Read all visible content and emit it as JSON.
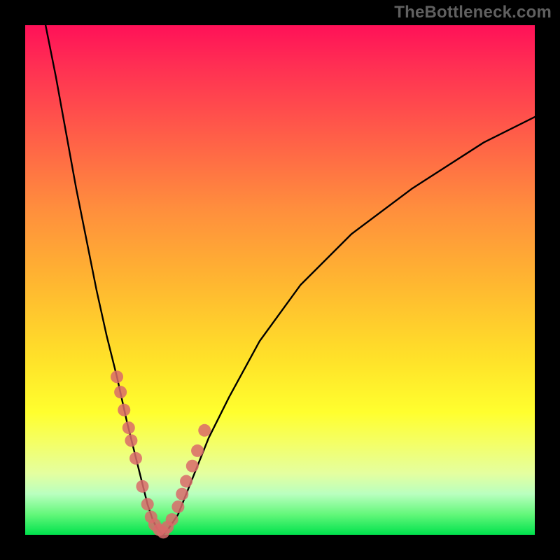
{
  "watermark": "TheBottleneck.com",
  "chart_data": {
    "type": "line",
    "title": "",
    "xlabel": "",
    "ylabel": "",
    "xlim": [
      0,
      100
    ],
    "ylim": [
      0,
      100
    ],
    "grid": false,
    "legend": false,
    "series": [
      {
        "name": "bottleneck-curve",
        "x": [
          4,
          6,
          8,
          10,
          12,
          14,
          16,
          18,
          20,
          22,
          23,
          24,
          25,
          26,
          27,
          28,
          30,
          32,
          34,
          36,
          40,
          46,
          54,
          64,
          76,
          90,
          100
        ],
        "y": [
          100,
          90,
          79,
          68,
          58,
          48,
          39,
          31,
          22,
          14,
          10,
          6,
          3,
          1,
          0,
          1,
          4,
          9,
          14,
          19,
          27,
          38,
          49,
          59,
          68,
          77,
          82
        ]
      }
    ],
    "markers": {
      "name": "highlight-points",
      "color": "#d96a6a",
      "radius_px": 9,
      "x": [
        18.0,
        18.7,
        19.4,
        20.3,
        20.8,
        21.7,
        23.0,
        24.0,
        24.7,
        25.4,
        26.3,
        27.1,
        27.9,
        28.8,
        30.0,
        30.8,
        31.6,
        32.8,
        33.8,
        35.2
      ],
      "y": [
        31.0,
        28.0,
        24.5,
        21.0,
        18.5,
        15.0,
        9.5,
        6.0,
        3.5,
        2.0,
        1.0,
        0.5,
        1.5,
        3.0,
        5.5,
        8.0,
        10.5,
        13.5,
        16.5,
        20.5
      ]
    },
    "gradient_background": {
      "top_color": "#ff1158",
      "bottom_color": "#00e24d"
    }
  }
}
